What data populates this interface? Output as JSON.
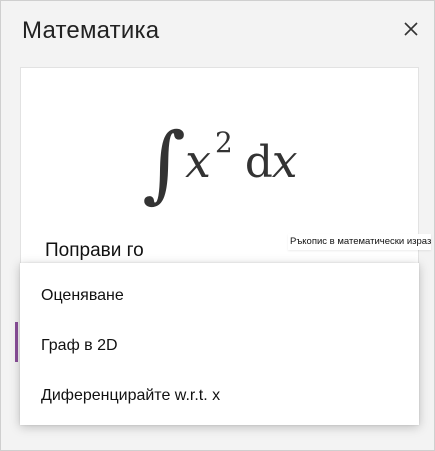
{
  "panel": {
    "title": "Математика",
    "close_icon": "close-icon"
  },
  "formula": {
    "display": "∫ x² dx",
    "integral": "∫",
    "variable": "x",
    "exponent": "2",
    "differential_d": "d",
    "differential_var": "x"
  },
  "fix": {
    "label": "Поправи го",
    "handwriting_button": "Ръкопис в математически израз"
  },
  "menu": {
    "items": [
      {
        "label": "Оценяване"
      },
      {
        "label": "Граф в 2D"
      },
      {
        "label": "Диференцирайте w.r.t. x"
      }
    ]
  },
  "colors": {
    "accent": "#8a4f9a",
    "panel_bg": "#f3f3f3",
    "card_bg": "#ffffff"
  }
}
